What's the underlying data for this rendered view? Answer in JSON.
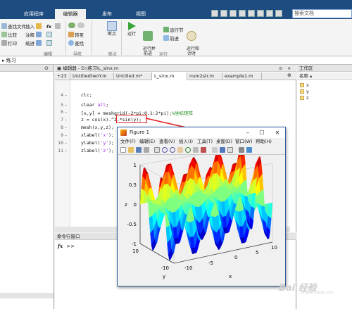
{
  "top_tabs": [
    "应用程序",
    "编辑器",
    "发布",
    "视图"
  ],
  "search_placeholder": "搜索文档",
  "ribbon": {
    "file_col": [
      "查找文件",
      "比较",
      "打印"
    ],
    "edit_col": [
      "插入",
      "注释",
      "缩进"
    ],
    "fx_label": "fx",
    "nav_col": [
      "转至",
      "查找"
    ],
    "breakpoints_label": "断点",
    "run_label": "运行",
    "run_advance_label": "运行并\n前进",
    "run_section_label": "运行节",
    "advance_label": "前进",
    "run_time_label": "运行和\n计时",
    "group_labels": [
      "编辑",
      "导航",
      "断点",
      "运行"
    ]
  },
  "path": "练习",
  "editor": {
    "title": "编辑器 - D:\\练习\\L_sinx.m",
    "tabs": [
      "+23",
      "UntitledtwoY.m",
      "Untitled.m*",
      "L_sinx.m",
      "num2str.m",
      "example1.m"
    ],
    "lines": [
      {
        "num": "4",
        "code": "clc;"
      },
      {
        "num": "5",
        "code": "clear all;"
      },
      {
        "num": "6",
        "code": "[x,y] = meshgrid(-2*pi:0.1:2*pi);%坐标矩阵"
      },
      {
        "num": "7",
        "code": "z = cos(x).^2.*sin(y);"
      },
      {
        "num": "8",
        "code": "mesh(x,y,z);"
      },
      {
        "num": "9",
        "code": "xlabel('x');"
      },
      {
        "num": "10",
        "code": "ylabel('y');"
      },
      {
        "num": "11",
        "code": "zlabel('z');"
      }
    ]
  },
  "workspace": {
    "title": "工作区",
    "header": "名称",
    "vars": [
      "x",
      "y",
      "z"
    ]
  },
  "command": {
    "title": "命令行窗口",
    "prompt": ">>",
    "fx": "fx"
  },
  "figure": {
    "title": "Figure 1",
    "menus": [
      "文件(F)",
      "编辑(E)",
      "查看(V)",
      "插入(I)",
      "工具(T)",
      "桌面(D)",
      "窗口(W)",
      "帮助(H)"
    ],
    "zticks": [
      "1",
      "0.5",
      "0",
      "-0.5",
      "-1"
    ],
    "xticks": [
      "-10",
      "-5",
      "0",
      "5",
      "10"
    ],
    "yticks": [
      "-10",
      "10"
    ],
    "xlabel": "x",
    "ylabel": "y",
    "zlabel": "z"
  },
  "watermark": "Bai 经验",
  "watermark_sub": "jingyan.baidu.com"
}
